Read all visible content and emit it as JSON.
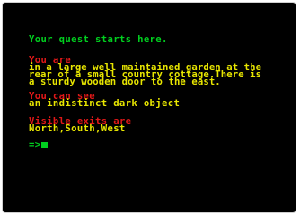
{
  "game": {
    "intro": "Your quest starts here.",
    "location_heading": "You are",
    "location_lines": [
      "in a large well maintained garden at the",
      "rear of a small country cottage.There is",
      "a sturdy wooden door to the east."
    ],
    "items_heading": "You can see",
    "items": "an indistinct dark object",
    "exits_heading": "Visible exits are",
    "exits": "North,South,West",
    "prompt": "=>"
  },
  "colors": {
    "background": "#000000",
    "green": "#00cf1f",
    "red": "#e01818",
    "yellow": "#e8e600"
  }
}
